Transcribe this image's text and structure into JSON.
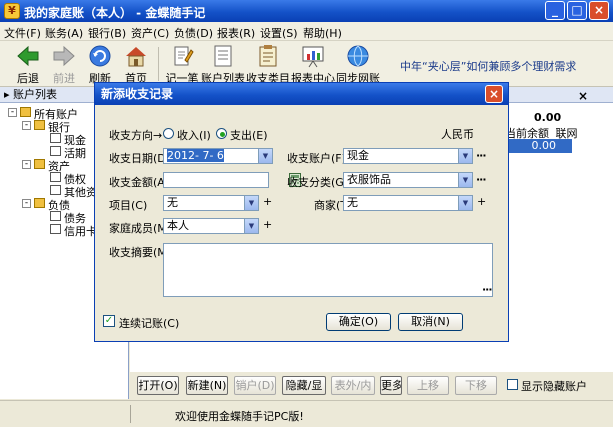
{
  "window": {
    "title": "我的家庭账（本人） - 金蝶随手记",
    "min": "0",
    "max": "1",
    "close": "×"
  },
  "menu": [
    "文件(F)",
    "账务(A)",
    "银行(B)",
    "资产(C)",
    "负债(D)",
    "报表(R)",
    "设置(S)",
    "帮助(H)"
  ],
  "toolbar": {
    "back": "后退",
    "forward": "前进",
    "refresh": "刷新",
    "home": "首页",
    "add_record": "记一笔",
    "account_list": "账户列表",
    "category": "收支类目",
    "report_center": "报表中心",
    "sync": "同步网账"
  },
  "ad_text": "中年“夹心层”如何兼顾多个理财需求",
  "left_panel": {
    "header": "账户列表",
    "tree": {
      "all": "所有账户",
      "bank": "银行",
      "cash": "现金",
      "current": "活期",
      "assets": "资产",
      "claims": "债权",
      "other_assets": "其他资",
      "liabilities": "负债",
      "debt": "债务",
      "credit_card": "信用卡"
    }
  },
  "right_panel": {
    "close": "×",
    "total": "0.00",
    "col_balance": "当前余额",
    "col_net": "联网",
    "row_value": "0.00"
  },
  "bottom_buttons": {
    "open": "打开(O)",
    "new": "新建(N)",
    "cancel_account": "销户(D)",
    "hide": "隐藏/显",
    "outer_inner": "表外/内",
    "more": "更多",
    "up": "上移",
    "down": "下移",
    "show_hidden": "显示隐藏账户"
  },
  "status": "欢迎使用金蝶随手记PC版!",
  "dialog": {
    "title": "新添收支记录",
    "close": "×",
    "direction_label": "收支方向→",
    "income": "收入(I)",
    "expense": "支出(E)",
    "currency": "人民币",
    "date_label": "收支日期(D)",
    "date_value": "2012- 7- 6",
    "account_label": "收支账户(F)",
    "account_value": "现金",
    "amount_label": "收支金额(A)",
    "amount_value": "",
    "category_label": "收支分类(G)",
    "category_value": "衣服饰品",
    "item_label": "项目(C)",
    "item_value": "无",
    "merchant_label": "商家(T)",
    "merchant_value": "无",
    "member_label": "家庭成员(M)",
    "member_value": "本人",
    "memo_label": "收支摘要(M)",
    "memo_value": "",
    "continuous": "连续记账(C)",
    "ok": "确定(O)",
    "cancel": "取消(N)",
    "more": "···",
    "plus": "+"
  }
}
